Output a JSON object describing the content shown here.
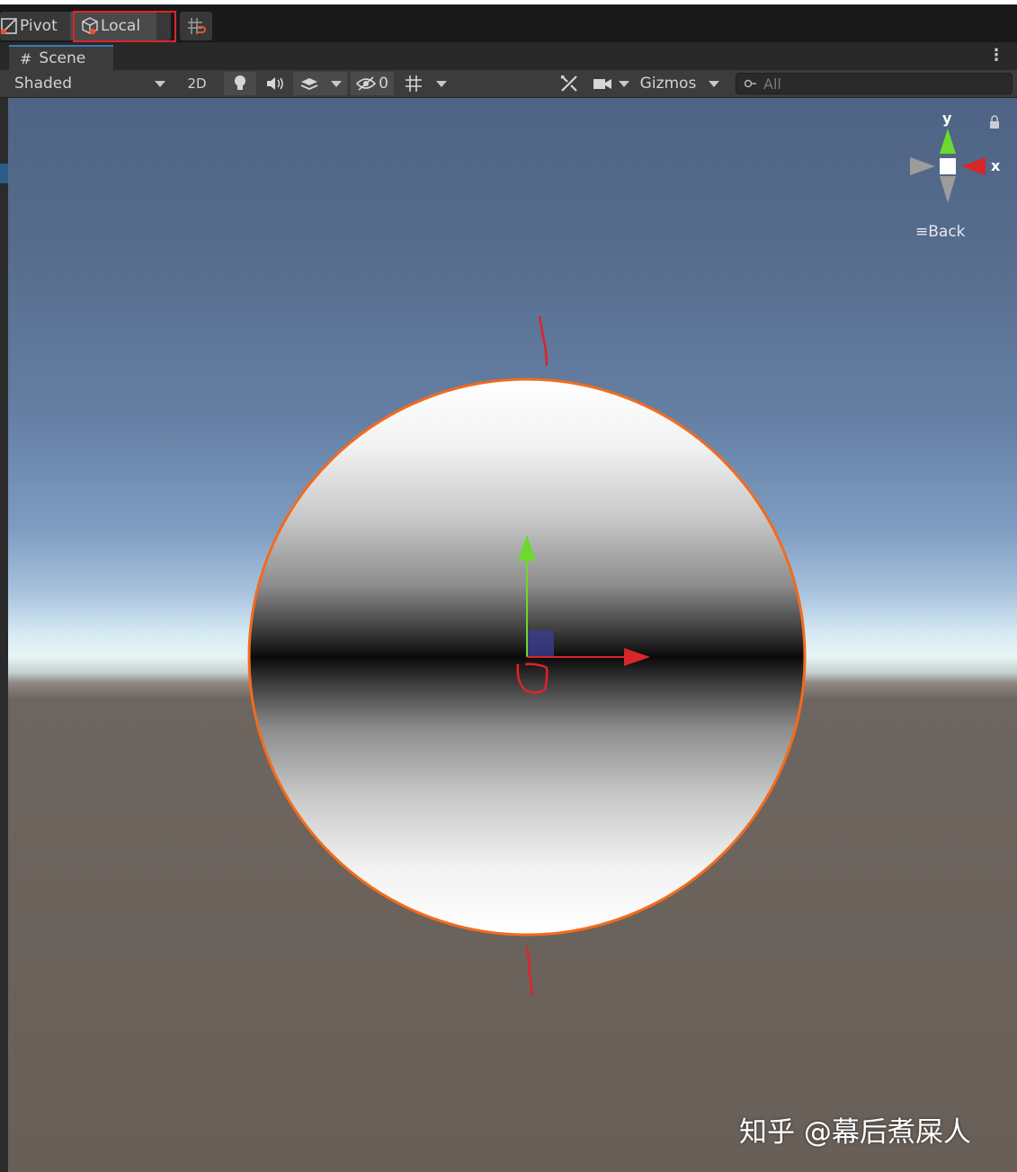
{
  "toolbar": {
    "pivot_label": "Pivot",
    "local_label": "Local"
  },
  "tab_bar": {
    "scene_tab_label": "Scene"
  },
  "scene_toolbar": {
    "draw_mode": "Shaded",
    "mode_2d": "2D",
    "hidden_count": "0",
    "gizmos_label": "Gizmos",
    "search_placeholder": "All"
  },
  "orientation_gizmo": {
    "y_label": "y",
    "x_label": "x",
    "view_label": "Back",
    "colors": {
      "y": "#6cd92e",
      "x": "#d8262a",
      "center": "#ffffff"
    }
  },
  "watermark": "知乎 @幕后煮屎人",
  "colors": {
    "annotation_red": "#e0232b",
    "selection_outline": "#f36b1c",
    "tab_accent": "#3a79bb"
  }
}
